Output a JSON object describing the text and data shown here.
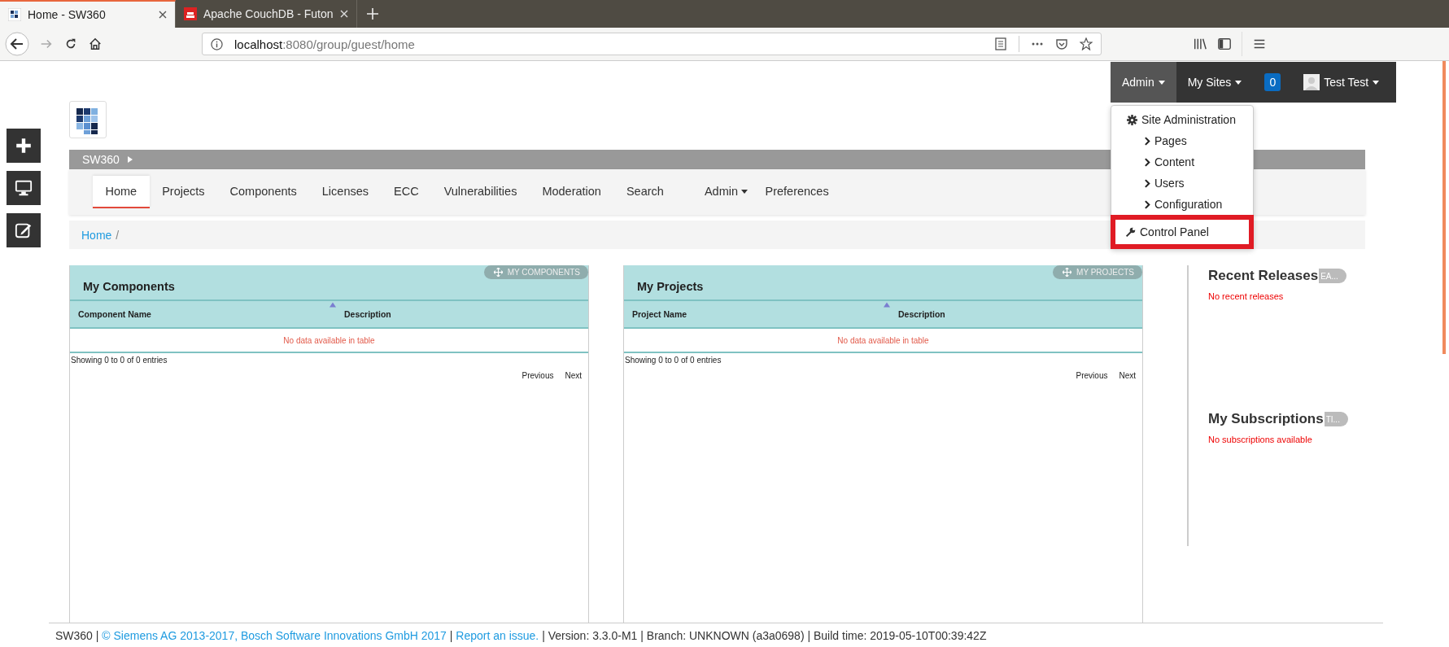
{
  "browser": {
    "tabs": [
      {
        "title": "Home - SW360",
        "selected": true,
        "kind": "grid"
      },
      {
        "title": "Apache CouchDB - Futon",
        "selected": false,
        "kind": "couch"
      }
    ],
    "url": {
      "host": "localhost",
      "path": ":8080/group/guest/home"
    }
  },
  "admin_bar": [
    {
      "label": "Admin",
      "kind": "menu",
      "selected": true
    },
    {
      "label": "My Sites",
      "kind": "menu",
      "selected": false
    },
    {
      "label": "0",
      "kind": "badge",
      "selected": false
    },
    {
      "label": "Test Test",
      "kind": "user",
      "selected": false
    }
  ],
  "dropdown": [
    {
      "label": "Site Administration",
      "kind": "header",
      "highlighted": false
    },
    {
      "label": "Pages",
      "kind": "sub",
      "highlighted": false
    },
    {
      "label": "Content",
      "kind": "sub",
      "highlighted": false
    },
    {
      "label": "Users",
      "kind": "sub",
      "highlighted": false
    },
    {
      "label": "Configuration",
      "kind": "sub",
      "highlighted": false
    },
    {
      "label": "Control Panel",
      "kind": "tool",
      "highlighted": true
    }
  ],
  "site": {
    "name": "SW360"
  },
  "nav": [
    {
      "label": "Home",
      "selected": true,
      "kind": "link"
    },
    {
      "label": "Projects",
      "selected": false,
      "kind": "link"
    },
    {
      "label": "Components",
      "selected": false,
      "kind": "link"
    },
    {
      "label": "Licenses",
      "selected": false,
      "kind": "link"
    },
    {
      "label": "ECC",
      "selected": false,
      "kind": "link"
    },
    {
      "label": "Vulnerabilities",
      "selected": false,
      "kind": "link"
    },
    {
      "label": "Moderation",
      "selected": false,
      "kind": "link"
    },
    {
      "label": "Search",
      "selected": false,
      "kind": "link"
    },
    {
      "label": "Admin",
      "selected": false,
      "kind": "menu"
    },
    {
      "label": "Preferences",
      "selected": false,
      "kind": "link"
    }
  ],
  "breadcrumb": [
    {
      "label": "Home",
      "separator": "/"
    }
  ],
  "portlets": [
    {
      "title": "My Components",
      "button": "MY COMPONENTS",
      "columns": [
        "Component Name",
        "Description"
      ],
      "empty": "No data available in table",
      "info": "Showing 0 to 0 of 0 entries",
      "pager": [
        "Previous",
        "Next"
      ]
    },
    {
      "title": "My Projects",
      "button": "MY PROJECTS",
      "columns": [
        "Project Name",
        "Description"
      ],
      "empty": "No data available in table",
      "info": "Showing 0 to 0 of 0 entries",
      "pager": [
        "Previous",
        "Next"
      ]
    }
  ],
  "side_sections": [
    {
      "title": "Recent Releases",
      "pill": "EA...",
      "message": "No recent releases"
    },
    {
      "title": "My Subscriptions",
      "pill": "TI...",
      "message": "No subscriptions available"
    }
  ],
  "footer": [
    {
      "text": "SW360 | ",
      "kind": "text"
    },
    {
      "text": "© Siemens AG 2013-2017, Bosch Software Innovations GmbH 2017",
      "kind": "link"
    },
    {
      "text": " | ",
      "kind": "text"
    },
    {
      "text": "Report an issue.",
      "kind": "link"
    },
    {
      "text": " | Version: 3.3.0-M1 | Branch: UNKNOWN (a3a0698) | Build time: 2019-05-10T00:39:42Z",
      "kind": "text"
    }
  ]
}
